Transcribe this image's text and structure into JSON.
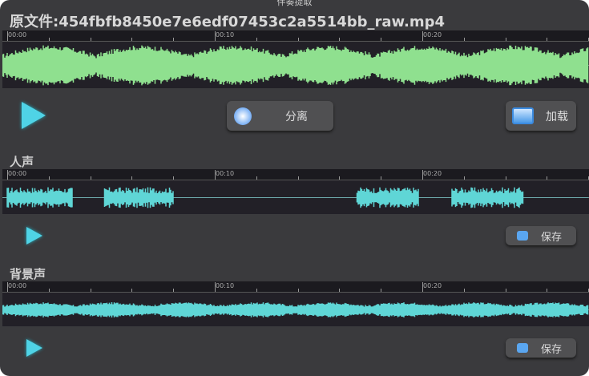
{
  "window": {
    "title": "伴奏提取"
  },
  "source": {
    "filename": "原文件:454fbfb8450e7e6edf07453c2a5514bb_raw.mp4",
    "wave_color": "#8fe08f"
  },
  "ruler": {
    "labels": [
      "00:00",
      "00:10",
      "00:20"
    ]
  },
  "controls": {
    "separate_label": "分离",
    "load_label": "加载"
  },
  "vocals": {
    "label": "人声",
    "save_label": "保存",
    "wave_color": "#5fd6d6"
  },
  "background": {
    "label": "背景声",
    "save_label": "保存",
    "wave_color": "#5fd6d6"
  }
}
